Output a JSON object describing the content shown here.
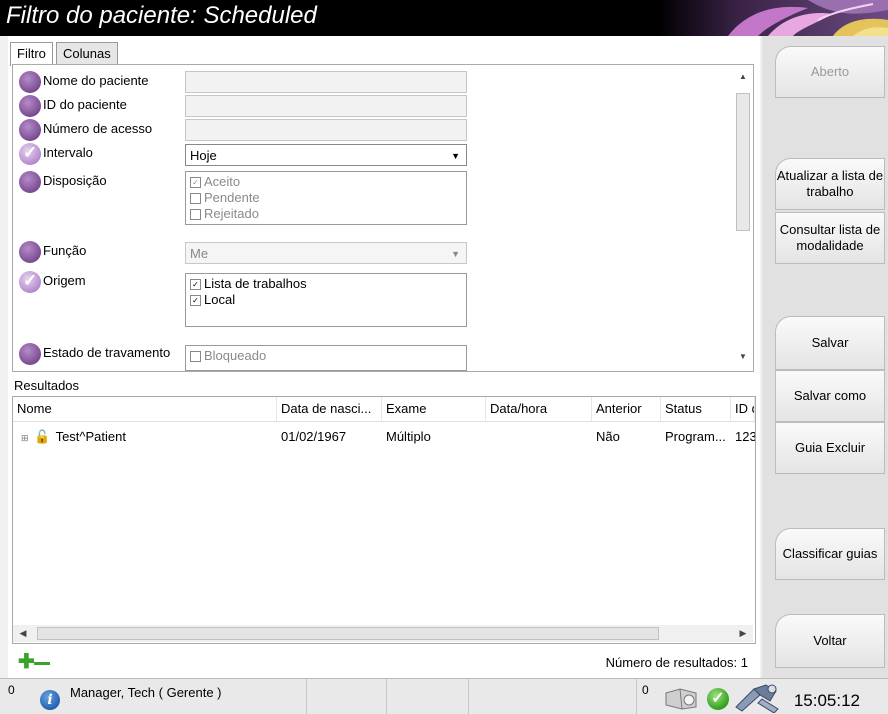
{
  "window": {
    "title": "Filtro do paciente: Scheduled"
  },
  "tabs": [
    {
      "label": "Filtro",
      "active": true
    },
    {
      "label": "Colunas",
      "active": false
    }
  ],
  "filters": {
    "patient_name": {
      "label": "Nome do paciente",
      "value": ""
    },
    "patient_id": {
      "label": "ID do paciente",
      "value": ""
    },
    "accession": {
      "label": "Número de acesso",
      "value": ""
    },
    "interval": {
      "label": "Intervalo",
      "value": "Hoje",
      "checked": true
    },
    "disposition": {
      "label": "Disposição",
      "options": [
        {
          "label": "Aceito",
          "checked": true
        },
        {
          "label": "Pendente",
          "checked": false
        },
        {
          "label": "Rejeitado",
          "checked": false
        }
      ]
    },
    "function": {
      "label": "Função",
      "value": "Me"
    },
    "origin": {
      "label": "Origem",
      "checked": true,
      "options": [
        {
          "label": "Lista de trabalhos",
          "checked": true
        },
        {
          "label": "Local",
          "checked": true
        }
      ]
    },
    "lock_state": {
      "label": "Estado de travamento",
      "option": "Bloqueado"
    }
  },
  "results": {
    "group_label": "Resultados",
    "columns": [
      "Nome",
      "Data de nasci...",
      "Exame",
      "Data/hora",
      "Anterior",
      "Status",
      "ID d"
    ],
    "rows": [
      {
        "name": "Test^Patient",
        "dob": "01/02/1967",
        "exam": "Múltiplo",
        "datetime": "",
        "prior": "Não",
        "status": "Program...",
        "id": "123"
      }
    ],
    "count_label": "Número de resultados: 1"
  },
  "sidebar": {
    "open": "Aberto",
    "refresh": "Atualizar a lista de trabalho",
    "query": "Consultar lista de modalidade",
    "save": "Salvar",
    "save_as": "Salvar como",
    "delete_tab": "Guia Excluir",
    "sort_tabs": "Classificar guias",
    "back": "Voltar"
  },
  "statusbar": {
    "left_count": "0",
    "user": "Manager, Tech ( Gerente )",
    "right_count": "0",
    "clock": "15:05:12"
  },
  "colors": {
    "accent_purple": "#7a4c92",
    "ok_green": "#2c9b18",
    "add_green": "#3aa32a"
  }
}
